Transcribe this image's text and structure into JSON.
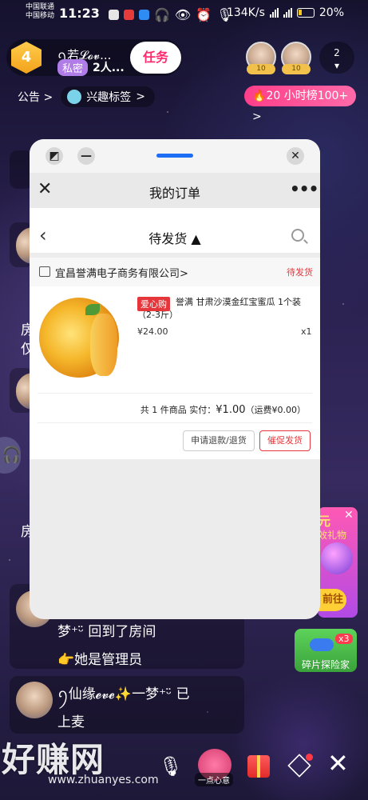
{
  "status_bar": {
    "carrier1": "中国联通",
    "carrier2": "中国移动",
    "time": "11:23",
    "speed": "134K/s",
    "battery": "20%"
  },
  "room": {
    "level": "4",
    "name": "ꪆ若𝓛𝓸𝓿...",
    "private_tag": "私密",
    "people": "2人...",
    "task_button": "任务",
    "badge1": "10",
    "badge2": "10",
    "count": "2",
    "notice": "公告",
    "notice_arrow": ">",
    "interest_tag": "兴趣标签",
    "interest_arrow": ">",
    "hour_rank": "20  小时榜100+",
    "hour_arrow": ">"
  },
  "chat": {
    "partial1": "房",
    "partial1b": "仅",
    "partial2": "房",
    "msg1_line1": "梦⁺ᵕ̈ 回到了房间",
    "msg1_line2": "👉她是管理员",
    "msg2_line1": "ꪆ仙缘𝓮𝓿𝓮✨一梦⁺ᵕ̈ 已",
    "msg2_line2": "上麦"
  },
  "banner": {
    "close": "✕",
    "text1": "元",
    "text2": "效礼物",
    "button": "前往",
    "game_badge": "x3",
    "game_label": "碎片探险家"
  },
  "bottom": {
    "watermark": "好赚网",
    "watermark_url": "www.zhuanyes.com",
    "kiss_label": "一点心意",
    "close": "✕"
  },
  "panel": {
    "minimize": "—",
    "close": "✕",
    "title": "我的订单",
    "more": "•••",
    "filter": "待发货 ▲",
    "store_name": "宜昌誉满电子商务有限公司>",
    "order_status": "待发货",
    "tag": "爱心购",
    "product_name": "誉满 甘肃沙漠金红宝蜜瓜 1个装（2-3斤）",
    "price": "¥24.00",
    "quantity": "x1",
    "summary_prefix": "共 1 件商品  实付：",
    "summary_amount": "¥1.00",
    "summary_suffix": "（运费¥0.00）",
    "refund_button": "申请退款/退货",
    "urge_button": "催促发货"
  }
}
